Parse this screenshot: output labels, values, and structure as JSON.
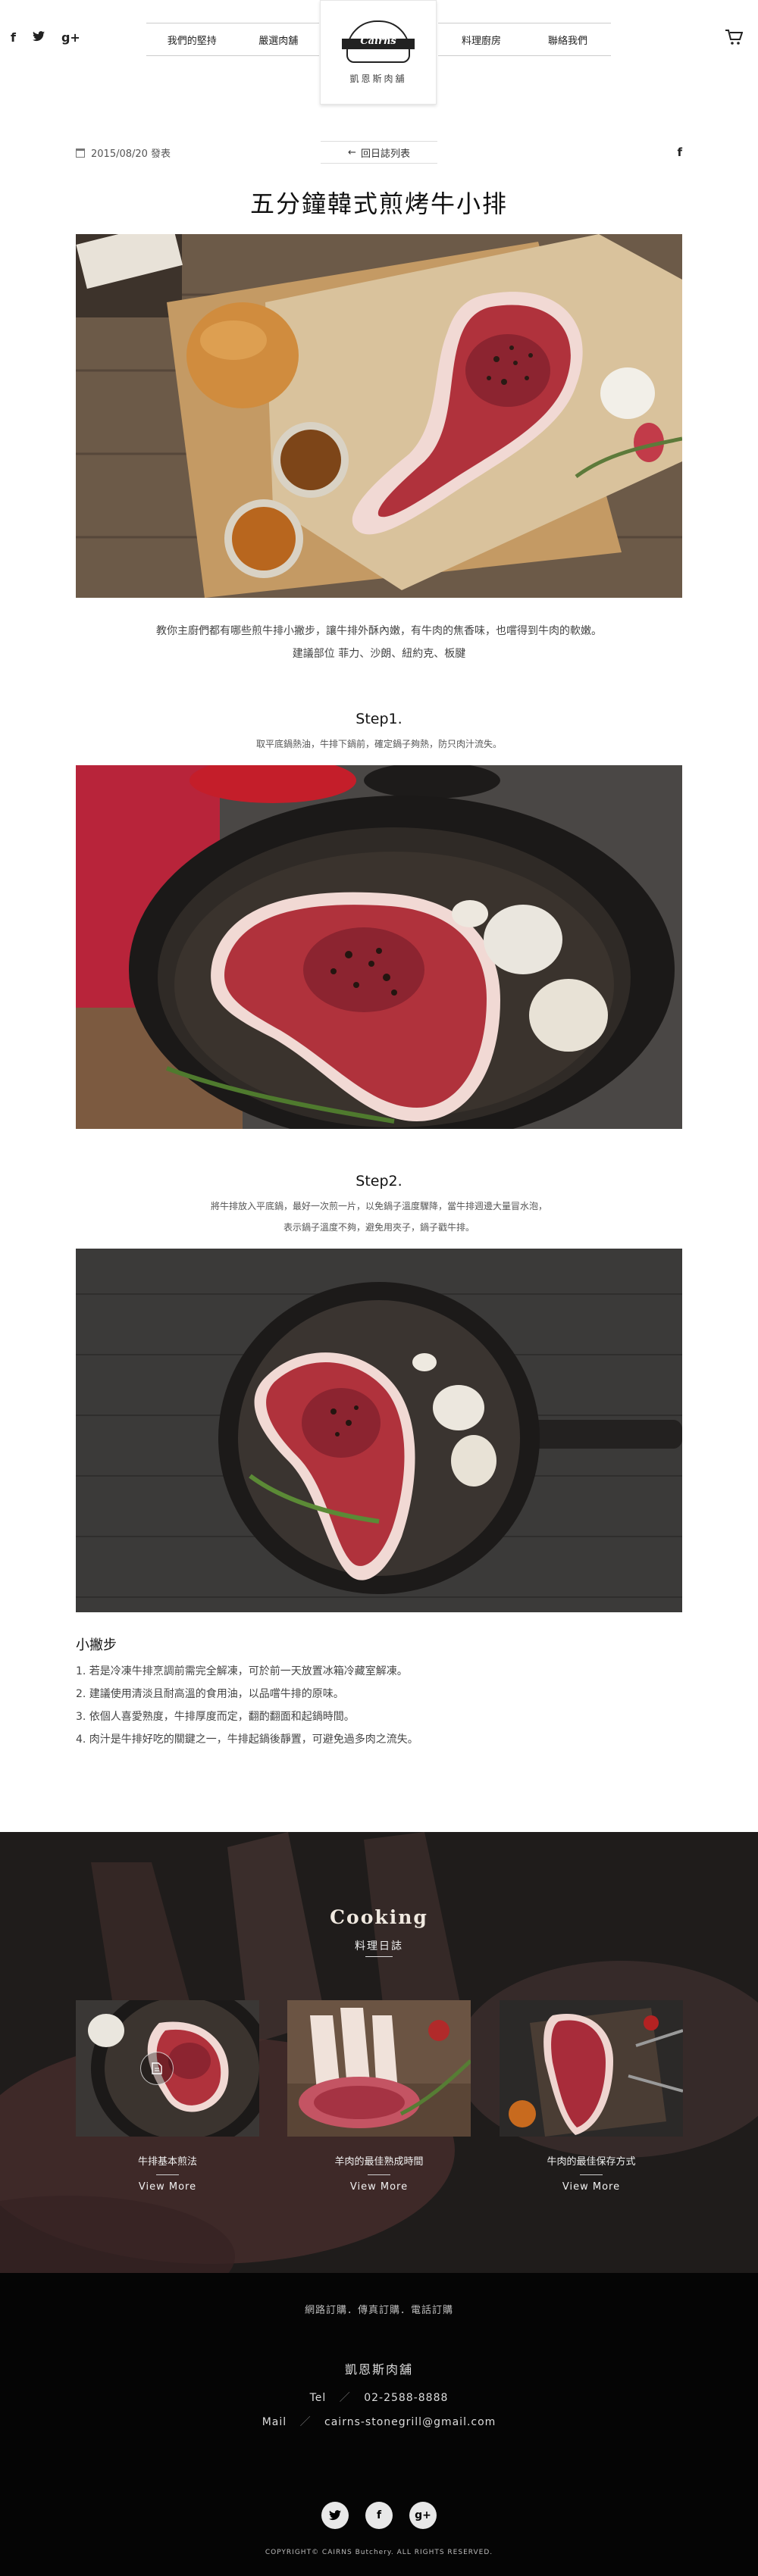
{
  "header": {
    "social": {
      "facebook": "f",
      "googleplus": "g+"
    },
    "nav_left": [
      "我們的堅持",
      "嚴選肉舖"
    ],
    "nav_right": [
      "料理廚房",
      "聯絡我們"
    ],
    "logo": {
      "emblem_text": "Cairns",
      "subtitle": "凱恩斯肉舖"
    }
  },
  "article": {
    "date": "2015/08/20 發表",
    "back_label": "回日誌列表",
    "back_arrow": "←",
    "share": "f",
    "title": "五分鐘韓式煎烤牛小排",
    "intro": [
      "教你主廚們都有哪些煎牛排小撇步，讓牛排外酥內嫩，有牛肉的焦香味，也嚐得到牛肉的軟嫩。",
      "建議部位 菲力、沙朗、紐約克、板腱"
    ],
    "steps": [
      {
        "title": "Step1.",
        "desc": [
          "取平底鍋熱油，牛排下鍋前，確定鍋子夠熱，防只肉汁流失。"
        ]
      },
      {
        "title": "Step2.",
        "desc": [
          "將牛排放入平底鍋，最好一次煎一片，以免鍋子溫度驟降，當牛排週邊大量冒水泡，",
          "表示鍋子溫度不夠，避免用夾子，鍋子戳牛排。"
        ]
      }
    ],
    "tips_title": "小撇步",
    "tips": [
      "1. 若是冷凍牛排烹調前需完全解凍，可於前一天放置冰箱冷藏室解凍。",
      "2. 建議使用清淡且耐高溫的食用油，以品嚐牛排的原味。",
      "3. 依個人喜愛熟度，牛排厚度而定，翻酌翻面和起鍋時間。",
      "4. 肉汁是牛排好吃的關鍵之一，牛排起鍋後靜置，可避免過多肉之流失。"
    ]
  },
  "cooking": {
    "heading": "Cooking",
    "subheading": "料理日誌",
    "cards": [
      {
        "title": "牛排基本煎法",
        "more": "View More"
      },
      {
        "title": "羊肉的最佳熟成時間",
        "more": "View More"
      },
      {
        "title": "牛肉的最佳保存方式",
        "more": "View More"
      }
    ]
  },
  "footer": {
    "order_line": "網路訂購．傳真訂購．電話訂購",
    "shop_name": "凱恩斯肉舖",
    "tel_label": "Tel",
    "tel": "02-2588-8888",
    "mail_label": "Mail",
    "mail": "cairns-stonegrill@gmail.com",
    "separator": "／",
    "social": {
      "twitter": "t",
      "facebook": "f",
      "googleplus": "g+"
    },
    "copyright": "COPYRIGHT© CAIRNS Butchery. ALL RIGHTS RESERVED."
  },
  "colors": {
    "footer_bg": "#050505",
    "cooking_bg": "#262322",
    "meat_red": "#b0323c",
    "fat_white": "#f1d9d4"
  }
}
